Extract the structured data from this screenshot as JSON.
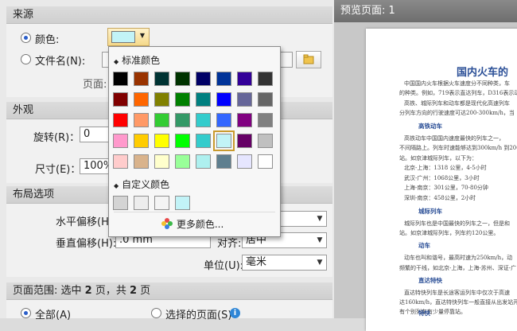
{
  "source": {
    "header": "来源",
    "color_label": "颜色:",
    "color_value": "#c2f3f7",
    "filename_label": "文件名(N):",
    "page_label": "页面:"
  },
  "appearance": {
    "header": "外观",
    "rotation_label": "旋转(R)：",
    "rotation_value": "0",
    "size_label": "尺寸(E)：",
    "size_value": "100%"
  },
  "layout": {
    "header": "布局选项",
    "h_offset_label": "水平偏移(H):",
    "v_offset_label": "垂直偏移(H):",
    "v_offset_value": ".0 mm",
    "align_label": "对齐:",
    "align_value": "居中",
    "unit_label": "单位(U):",
    "unit_value": "毫米"
  },
  "page_range": {
    "header_prefix": "页面范围: 选中 ",
    "selected_count": "2",
    "header_middle": " 页，共 ",
    "total_count": "2",
    "header_suffix": " 页",
    "all_label": "全部(A)",
    "selected_pages_label": "选择的页面(S)"
  },
  "color_picker": {
    "standard_header": "标准颜色",
    "custom_header": "自定义颜色",
    "more_colors": "更多颜色...",
    "standard_colors": [
      [
        "#000000",
        "#993300",
        "#003333",
        "#003300",
        "#000066",
        "#003399",
        "#330099",
        "#333333"
      ],
      [
        "#800000",
        "#ff6600",
        "#808000",
        "#008000",
        "#008080",
        "#0000ff",
        "#666699",
        "#666666"
      ],
      [
        "#ff0000",
        "#ff9966",
        "#33cc33",
        "#339966",
        "#33cccc",
        "#3366ff",
        "#800080",
        "#808080"
      ],
      [
        "#ff99cc",
        "#ffcc00",
        "#ffff00",
        "#00ff00",
        "#33cccc",
        "#c2f3f7",
        "#660066",
        "#c0c0c0"
      ],
      [
        "#ffcccc",
        "#d9b38c",
        "#ffffcc",
        "#99ff99",
        "#aef0ef",
        "#5f7f8f",
        "#e6e6ff",
        "#ffffff"
      ]
    ],
    "selected_color": "#c2f3f7",
    "custom_colors": [
      "#d4d4d4",
      "#ededed",
      "#f4f4f4",
      "#c2f3f7"
    ]
  },
  "preview": {
    "title": "预览页面: 1",
    "doc_title": "国内火车的",
    "lines": [
      "中国国内火车根据火车速度分不同种类，车",
      "的种类。例如，719表示直达列车，D316表示动",
      "高铁、城际列车和动车都是现代化高速列车",
      "分列车方向的行驶速度可达200-300km/h，当"
    ],
    "h1": "高铁动车",
    "lines2": [
      "高铁动车中国国内速度最快的列车之一，",
      "不间隔路上。列车时速能够达到300km/h 到200",
      "站。如京津城际列车，以下为：",
      "北京-上海：1318 公里，4-5小时",
      "武汉-广州：1068公里，3小时",
      "上海-南京：301公里，70-80分钟",
      "深圳-南京：458公里，2小时"
    ],
    "h2": "城际列车",
    "lines3": [
      "城际列车也是中国最快的列车之一，但是和",
      "站。如京津城际列车，列车约120公里。"
    ],
    "h3": "动车",
    "lines4": [
      "动车也叫和谐号，最高时速为250km/h，动",
      "频繁的干线，如北京-上海，上海-苏州、深证-广"
    ],
    "h4": "直达特快",
    "lines5": [
      "直达特快列车是长途客运列车中仅次于高速",
      "达160km/h，直达特快列车一般直接从出发站开到",
      "有个别列车有少量停靠站。"
    ],
    "h5": "特快"
  }
}
